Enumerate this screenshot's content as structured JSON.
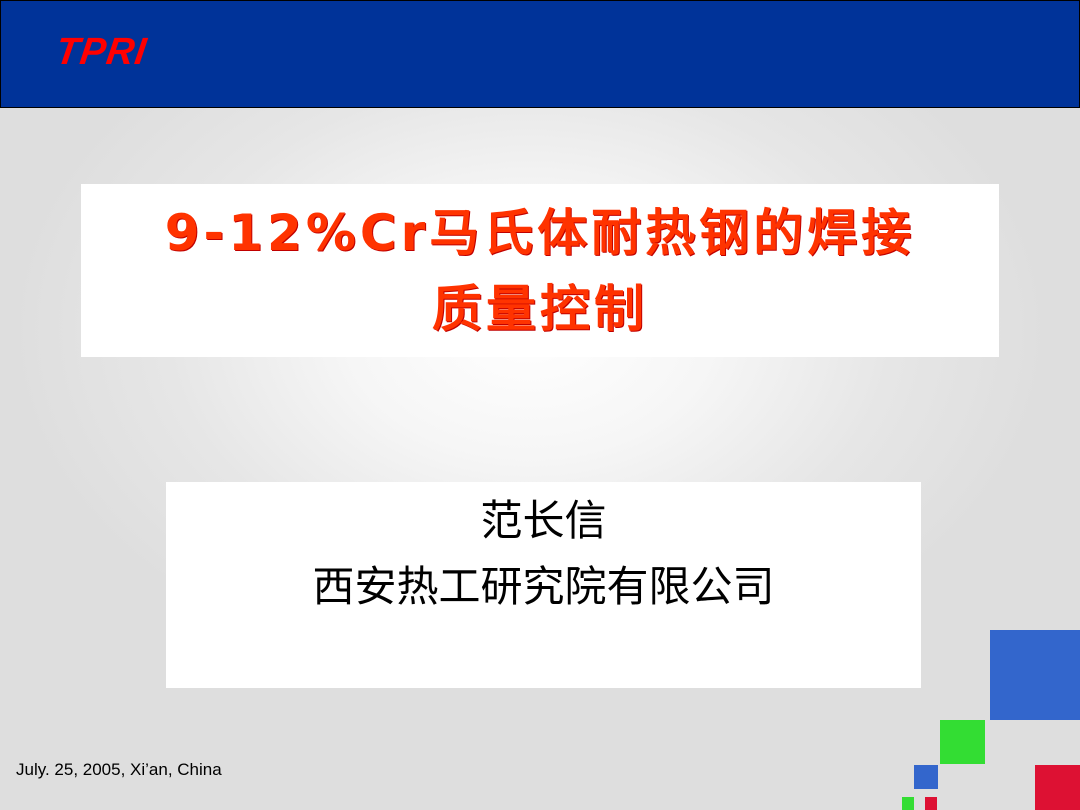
{
  "header": {
    "logo_text": "TPRI",
    "bg_color": "#003399",
    "logo_color": "#ff0000"
  },
  "title": {
    "line1": "9-12%Cr马氏体耐热钢的焊接",
    "line2": "质量控制",
    "color": "#ff3300"
  },
  "author": {
    "name": "范长信",
    "organization": "西安热工研究院有限公司"
  },
  "footer": {
    "date_location": "July. 25, 2005, Xi’an, China"
  },
  "decor": {
    "squares": [
      "blue",
      "green",
      "blue",
      "red",
      "green",
      "red"
    ]
  }
}
